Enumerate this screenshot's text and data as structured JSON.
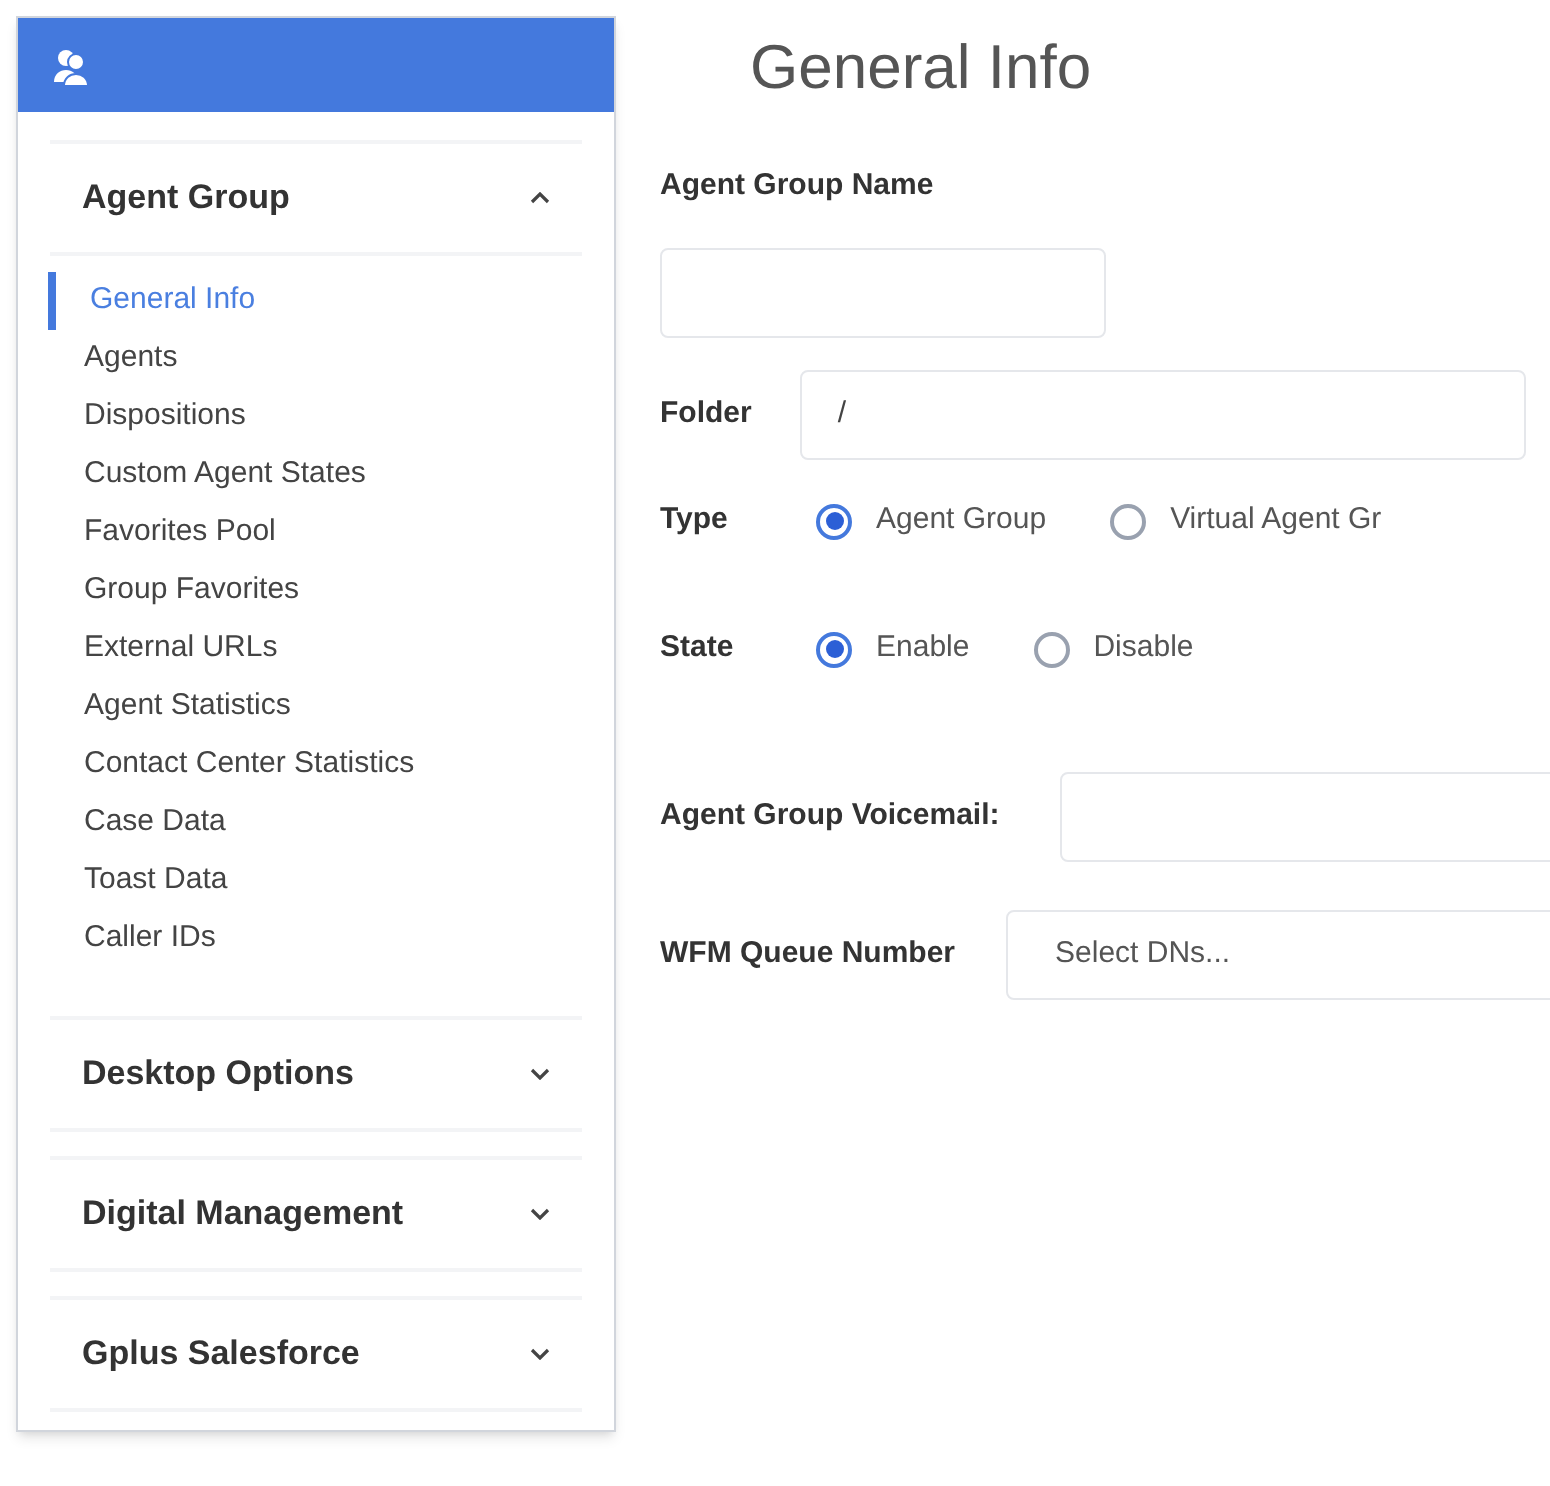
{
  "sidebar": {
    "sections": [
      {
        "title": "Agent Group",
        "expanded": true,
        "items": [
          {
            "label": "General Info",
            "selected": true
          },
          {
            "label": "Agents",
            "selected": false
          },
          {
            "label": "Dispositions",
            "selected": false
          },
          {
            "label": "Custom Agent States",
            "selected": false
          },
          {
            "label": "Favorites Pool",
            "selected": false
          },
          {
            "label": "Group Favorites",
            "selected": false
          },
          {
            "label": "External URLs",
            "selected": false
          },
          {
            "label": "Agent Statistics",
            "selected": false
          },
          {
            "label": "Contact Center Statistics",
            "selected": false
          },
          {
            "label": "Case Data",
            "selected": false
          },
          {
            "label": "Toast Data",
            "selected": false
          },
          {
            "label": "Caller IDs",
            "selected": false
          }
        ]
      },
      {
        "title": "Desktop Options",
        "expanded": false
      },
      {
        "title": "Digital Management",
        "expanded": false
      },
      {
        "title": "Gplus Salesforce",
        "expanded": false
      }
    ]
  },
  "form": {
    "title": "General Info",
    "fields": [
      {
        "kind": "stacked",
        "label": "Agent Group Name"
      },
      {
        "kind": "input",
        "label": "Folder",
        "value": "/"
      },
      {
        "kind": "radio",
        "label": "Type",
        "options": [
          {
            "label": "Agent Group",
            "selected": true
          },
          {
            "label": "Virtual Agent Gr",
            "selected": false
          }
        ]
      },
      {
        "kind": "radio",
        "label": "State",
        "options": [
          {
            "label": "Enable",
            "selected": true
          },
          {
            "label": "Disable",
            "selected": false
          }
        ]
      },
      {
        "kind": "input",
        "label": "Agent Group Voicemail:"
      },
      {
        "kind": "select",
        "label": "WFM Queue Number",
        "placeholder": "Select DNs..."
      }
    ]
  }
}
